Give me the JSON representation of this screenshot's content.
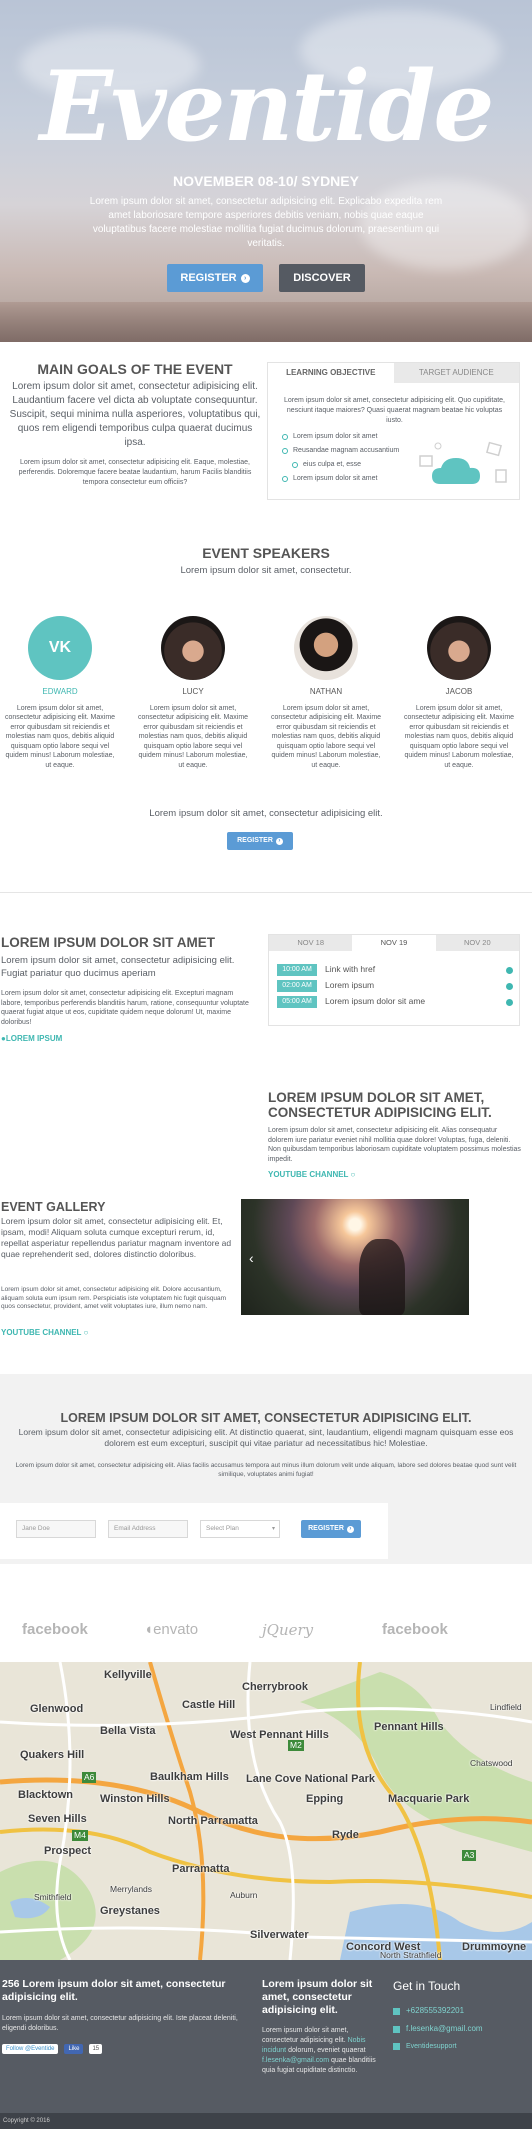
{
  "hero": {
    "logo": "Eventide",
    "date": "NOVEMBER 08-10/ SYDNEY",
    "text": "Lorem ipsum dolor sit amet, consectetur adipisicing elit. Explicabo expedita rem amet laboriosare tempore asperiores debitis veniam, nobis quae eaque voluptatibus facere molestiae mollitia fugiat ducimus dolorum, praesentium qui veritatis.",
    "register_label": "REGISTER",
    "discover_label": "DISCOVER"
  },
  "goals": {
    "title": "MAIN GOALS OF THE EVENT",
    "lead": "Lorem ipsum dolor sit amet, consectetur adipisicing elit. Laudantium facere vel dicta ab voluptate consequuntur. Suscipit, sequi minima nulla asperiores, voluptatibus qui, quos rem eligendi temporibus culpa quaerat ducimus ipsa.",
    "small": "Lorem ipsum dolor sit amet, consectetur adipisicing elit. Eaque, molestiae, perferendis. Doloremque facere beatae laudantium, harum Facilis blanditiis tempora consectetur eum officiis?",
    "tabs": [
      "LEARNING OBJECTIVE",
      "TARGET AUDIENCE"
    ],
    "tab_text": "Lorem ipsum dolor sit amet, consectetur adipisicing elit. Quo cupiditate, nesciunt itaque maiores? Quasi quaerat magnam beatae hic voluptas iusto.",
    "items": [
      "Lorem ipsum dolor sit amet",
      "Reusandae magnam accusantium",
      "eius culpa et, esse",
      "Lorem ipsum dolor sit amet"
    ]
  },
  "speakers": {
    "title": "EVENT SPEAKERS",
    "subtitle": "Lorem ipsum dolor sit amet, consectetur.",
    "people": [
      {
        "name": "EDWARD",
        "avatar_text": "VK",
        "desc": "Lorem ipsum dolor sit amet, consectetur adipisicing elit. Maxime error quibusdam sit reiciendis et molestias nam quos, debitis aliquid quisquam optio labore sequi vel quidem minus! Laborum molestiae, ut eaque."
      },
      {
        "name": "LUCY",
        "desc": "Lorem ipsum dolor sit amet, consectetur adipisicing elit. Maxime error quibusdam sit reiciendis et molestias nam quos, debitis aliquid quisquam optio labore sequi vel quidem minus! Laborum molestiae, ut eaque."
      },
      {
        "name": "NATHAN",
        "desc": "Lorem ipsum dolor sit amet, consectetur adipisicing elit. Maxime error quibusdam sit reiciendis et molestias nam quos, debitis aliquid quisquam optio labore sequi vel quidem minus! Laborum molestiae, ut eaque."
      },
      {
        "name": "JACOB",
        "desc": "Lorem ipsum dolor sit amet, consectetur adipisicing elit. Maxime error quibusdam sit reiciendis et molestias nam quos, debitis aliquid quisquam optio labore sequi vel quidem minus! Laborum molestiae, ut eaque."
      }
    ],
    "lower_text": "Lorem ipsum dolor sit amet, consectetur adipisicing elit.",
    "register_label": "REGISTER"
  },
  "schedule": {
    "title": "LOREM IPSUM DOLOR SIT AMET",
    "lead": "Lorem ipsum dolor sit amet, consectetur adipisicing elit. Fugiat pariatur quo ducimus aperiam",
    "small": "Lorem ipsum dolor sit amet, consectetur adipisicing elit. Excepturi magnam labore, temporibus perferendis blanditiis harum, ratione, consequuntur voluptate quaerat fugiat atque ut eos, cupiditate quidem neque dolorum! Ut, maxime doloribus!",
    "link": "LOREM IPSUM",
    "tabs": [
      "NOV 18",
      "NOV 19",
      "NOV 20"
    ],
    "rows": [
      {
        "time": "10:00 AM",
        "text": "Link with href"
      },
      {
        "time": "02:00 AM",
        "text": "Lorem ipsum"
      },
      {
        "time": "05:00 AM",
        "text": "Lorem ipsum dolor sit ame"
      }
    ]
  },
  "youtube": {
    "title": "LOREM IPSUM DOLOR SIT AMET, CONSECTETUR ADIPISICING ELIT.",
    "text": "Lorem ipsum dolor sit amet, consectetur adipisicing elit. Alias consequatur dolorem iure pariatur eveniet nihil mollitia quae dolore! Voluptas, fuga, deleniti. Non quibusdam temporibus laboriosam cupiditate voluptatem possimus molestias impedit.",
    "link": "YOUTUBE CHANNEL"
  },
  "gallery": {
    "title": "EVENT GALLERY",
    "lead": "Lorem ipsum dolor sit amet, consectetur adipisicing elit. Et, ipsam, modi! Aliquam soluta cumque excepturi rerum, id, repellat asperiatur repellendus pariatur magnam inventore ad quae reprehenderit sed, dolores distinctio doloribus.",
    "small": "Lorem ipsum dolor sit amet, consectetur adipisicing elit. Dolore accusantium, aliquam soluta eum ipsum rem. Perspiciatis iste voluptatem hic fugit quisquam quos consectetur, provident, amet velit voluptates iure, illum nemo nam.",
    "link": "YOUTUBE CHANNEL"
  },
  "cta": {
    "title": "LOREM IPSUM DOLOR SIT AMET, CONSECTETUR ADIPISICING ELIT.",
    "lead": "Lorem ipsum dolor sit amet, consectetur adipisicing elit. At distinctio quaerat, sint, laudantium, eligendi magnam quisquam esse eos dolorem est eum excepturi, suscipit qui vitae pariatur ad necessitatibus hic! Molestiae.",
    "small": "Lorem ipsum dolor sit amet, consectetur adipisicing elit. Alias facilis accusamus tempora aut minus illum dolorum velit unde aliquam, labore sed dolores beatae quod sunt velit similique, voluptates animi fugiat!",
    "name_placeholder": "Jane Doe",
    "email_placeholder": "Email Address",
    "plan_value": "Select Plan",
    "register_label": "REGISTER"
  },
  "logos": [
    "facebook",
    "envato",
    "jQuery",
    "facebook"
  ],
  "map": {
    "labels": [
      "Kellyville",
      "Cherrybrook",
      "Castle Hill",
      "Glenwood",
      "Bella Vista",
      "West Pennant Hills",
      "Pennant Hills",
      "Quakers Hill",
      "Baulkham Hills",
      "Blacktown",
      "Winston Hills",
      "Lane Cove National Park",
      "Epping",
      "Macquarie Park",
      "Seven Hills",
      "North Parramatta",
      "Ryde",
      "Prospect",
      "Parramatta",
      "Greystanes",
      "Silverwater",
      "Concord West",
      "Drummoyne",
      "Smithfield",
      "Merrylands",
      "Auburn",
      "North Strathfield",
      "Chatswood",
      "Lindfield"
    ],
    "road_badges": [
      "M4",
      "A6",
      "M2",
      "A3"
    ]
  },
  "footer": {
    "col1_title": "256 Lorem ipsum dolor sit amet, consectetur adipisicing elit.",
    "col1_text": "Lorem ipsum dolor sit amet, consectetur adipisicing elit. Iste placeat deleniti, eligendi doloribus.",
    "follow_label": "Follow @Eventide",
    "like_label": "Like",
    "like_count": "15",
    "col2_title": "Lorem ipsum dolor sit amet, consectetur adipisicing elit.",
    "col2_text_1": "Lorem ipsum dolor sit amet, consectetur adipisicing elit.",
    "col2_link_1": "Nobis incidunt",
    "col2_text_2": "dolorum, eveniet quaerat",
    "col2_link_2": "f.lesenka@gmail.com",
    "col2_text_3": "quae blanditiis quia fugiat cupiditate distinctio.",
    "col3_title": "Get in Touch",
    "phone": "+628555392201",
    "email": "f.lesenka@gmail.com",
    "skype": "Eventidesupport",
    "copyright": "Copyright © 2016"
  },
  "colors": {
    "accent": "#5b9bd5",
    "teal": "#3fb7b1",
    "dark": "#555a62",
    "footer": "#565b63"
  }
}
